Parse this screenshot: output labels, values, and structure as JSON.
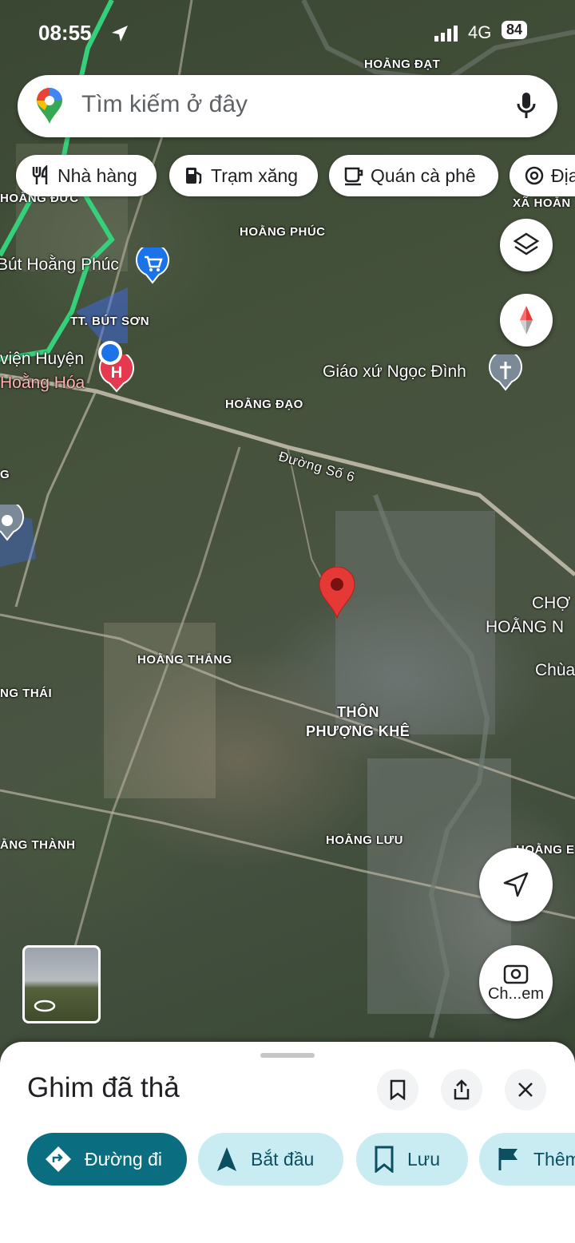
{
  "status_bar": {
    "time": "08:55",
    "network": "4G",
    "battery": "84"
  },
  "search": {
    "placeholder": "Tìm kiếm ở đây"
  },
  "chips": [
    {
      "label": "Nhà hàng",
      "icon": "fork-knife-icon"
    },
    {
      "label": "Trạm xăng",
      "icon": "gas-station-icon"
    },
    {
      "label": "Quán cà phê",
      "icon": "coffee-cup-icon"
    },
    {
      "label": "Địa",
      "icon": "attraction-icon"
    }
  ],
  "map_labels": {
    "hoang_dat": "HOẰNG ĐẠT",
    "hoang_duc": "HOẰNG ĐỨC",
    "xa_hoang": "XÃ HOẰN",
    "hoang_phuc": "HOẰNG PHÚC",
    "but_hoang_phuc": "Bút Hoằng Phúc",
    "tt_but_son": "TT. BÚT SƠN",
    "vien_huyen": "viện Huyện",
    "hoang_hoa": "Hoằng Hóa",
    "giao_xu": "Giáo xứ Ngọc Đình",
    "hoang_dao": "HOẰNG ĐẠO",
    "duong_so_6": "Đường Số 6",
    "g_label": "G",
    "cho": "CHỢ",
    "hoang_n": "HOẰNG N",
    "chua": "Chùa",
    "hoang_thang": "HOẰNG THẮNG",
    "ng_thai": "NG THÁI",
    "thon": "THÔN",
    "phuong_khe": "PHƯỢNG KHÊ",
    "ang_thanh": "ẰNG THÀNH",
    "hoang_luu": "HOẰNG LƯU",
    "hoang_e": "HOẰNG E"
  },
  "side_buttons": {
    "camera_label": "Ch...em"
  },
  "sheet": {
    "title": "Ghim đã thả",
    "actions": [
      {
        "label": "Đường đi"
      },
      {
        "label": "Bắt đầu"
      },
      {
        "label": "Lưu"
      },
      {
        "label": "Thêm"
      }
    ]
  },
  "colors": {
    "accent": "#0b6e80",
    "action_bg": "#c9ecf3",
    "pin": "#e53935",
    "route": "#35d17a",
    "location": "#1a73e8"
  }
}
